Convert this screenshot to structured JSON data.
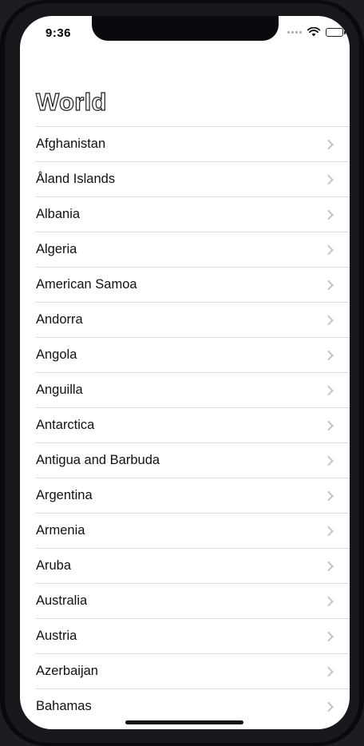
{
  "status_bar": {
    "time": "9:36"
  },
  "title": "World",
  "countries": [
    "Afghanistan",
    "Åland Islands",
    "Albania",
    "Algeria",
    "American Samoa",
    "Andorra",
    "Angola",
    "Anguilla",
    "Antarctica",
    "Antigua and Barbuda",
    "Argentina",
    "Armenia",
    "Aruba",
    "Australia",
    "Austria",
    "Azerbaijan",
    "Bahamas"
  ],
  "icons": {
    "row_accessory": "chevron-right-icon",
    "signal": "cellular-signal-icon",
    "wifi": "wifi-icon",
    "battery": "battery-icon"
  }
}
